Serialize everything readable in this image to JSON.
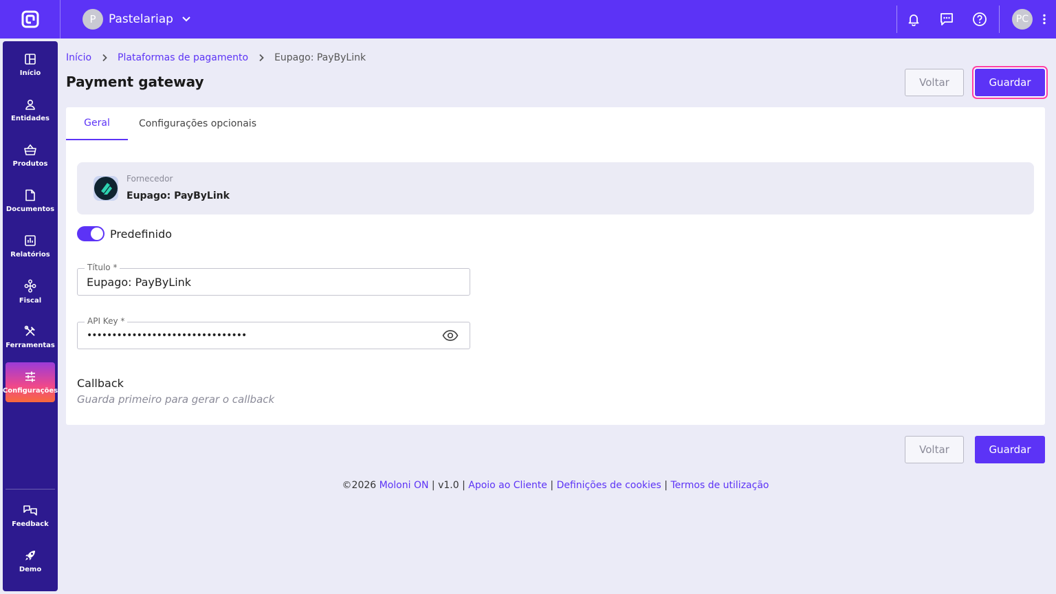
{
  "topbar": {
    "company_initial": "P",
    "company_name": "Pastelariap",
    "user_initials": "PC",
    "icons": [
      "bell-icon",
      "chat-icon",
      "help-icon",
      "kebab-menu-icon"
    ]
  },
  "sidebar": {
    "items": [
      {
        "label": "Início",
        "icon": "dashboard-icon"
      },
      {
        "label": "Entidades",
        "icon": "user-icon"
      },
      {
        "label": "Produtos",
        "icon": "basket-icon"
      },
      {
        "label": "Documentos",
        "icon": "document-icon"
      },
      {
        "label": "Relatórios",
        "icon": "chart-icon"
      },
      {
        "label": "Fiscal",
        "icon": "fiscal-icon"
      },
      {
        "label": "Ferramentas",
        "icon": "tools-icon"
      },
      {
        "label": "Configurações",
        "icon": "settings-sliders-icon",
        "active": true
      }
    ],
    "bottom_items": [
      {
        "label": "Feedback",
        "icon": "feedback-icon"
      },
      {
        "label": "Demo",
        "icon": "rocket-icon"
      }
    ]
  },
  "breadcrumb": {
    "items": [
      "Início",
      "Plataformas de pagamento",
      "Eupago: PayByLink"
    ]
  },
  "page": {
    "title": "Payment gateway",
    "back_label": "Voltar",
    "save_label": "Guardar"
  },
  "tabs": [
    "Geral",
    "Configurações opcionais"
  ],
  "provider": {
    "label": "Fornecedor",
    "name": "Eupago: PayByLink"
  },
  "toggle": {
    "label": "Predefinido",
    "on": true
  },
  "form": {
    "title_label": "Título *",
    "title_value": "Eupago: PayByLink",
    "apikey_label": "API Key *",
    "apikey_value": "••••••••••••••••••••••••••••••••"
  },
  "callback": {
    "title": "Callback",
    "hint": "Guarda primeiro para gerar o callback"
  },
  "footer": {
    "copyright": "©2026",
    "brand": "Moloni ON",
    "version": "v1.0",
    "support": "Apoio ao Cliente",
    "cookies": "Definições de cookies",
    "terms": "Termos de utilização"
  },
  "colors": {
    "accent": "#5c33f6",
    "sidebar": "#2d1a8f",
    "focus_ring": "#ff3ea5"
  }
}
